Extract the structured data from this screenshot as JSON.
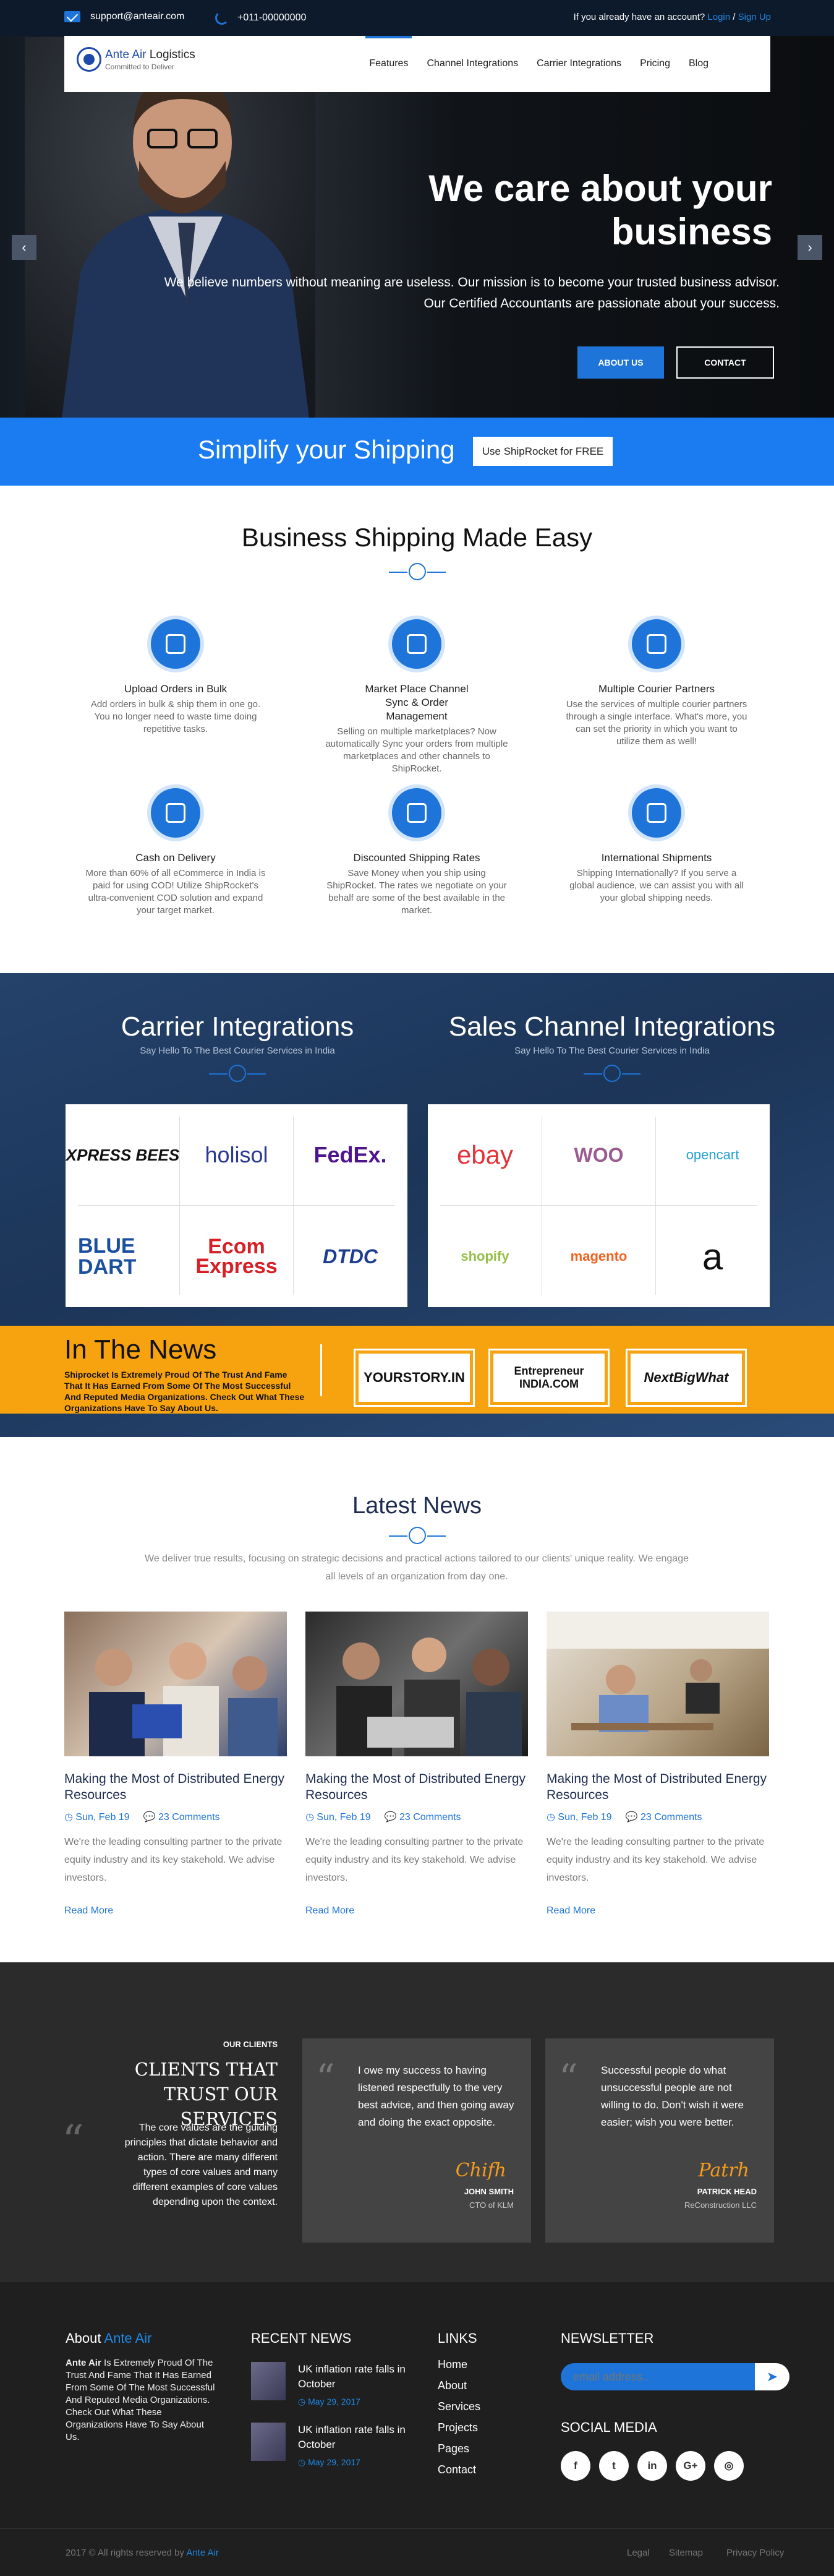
{
  "topbar": {
    "email": "support@anteair.com",
    "phone": "+011-00000000",
    "account_text": "If you already have an account?",
    "login": "Login",
    "sep": "/",
    "signup": "Sign Up"
  },
  "logo": {
    "name_part1": "Ante Air",
    "name_part2": "Logistics",
    "tagline": "Committed to Deliver"
  },
  "nav": [
    "Features",
    "Channel Integrations",
    "Carrier Integrations",
    "Pricing",
    "Blog"
  ],
  "hero": {
    "title": "We care about your business",
    "subtitle": "We believe numbers without meaning are useless. Our mission is to become your trusted business advisor. Our Certified Accountants are passionate about your success.",
    "btn_about": "ABOUT US",
    "btn_contact": "CONTACT",
    "prev": "‹",
    "next": "›"
  },
  "simplify": {
    "text": "Simplify your Shipping",
    "button": "Use ShipRocket for FREE"
  },
  "business": {
    "title": "Business Shipping Made Easy",
    "features": [
      {
        "icon": "upload-icon",
        "title": "Upload Orders in Bulk",
        "desc": "Add orders in bulk & ship them in one go. You no longer need to waste time doing repetitive tasks."
      },
      {
        "icon": "sync-icon",
        "title": "Market Place Channel Sync & Order Management",
        "desc": "Selling on multiple marketplaces? Now automatically Sync your orders from multiple marketplaces and other channels to ShipRocket."
      },
      {
        "icon": "handshake-icon",
        "title": "Multiple Courier Partners",
        "desc": "Use the services of multiple courier partners through a single interface. What's more, you can set the priority in which you want to utilize them as well!"
      },
      {
        "icon": "delivery-truck-icon",
        "title": "Cash on Delivery",
        "desc": "More than 60% of all eCommerce in India is paid for using COD! Utilize ShipRocket's ultra-convenient COD solution and expand your target market."
      },
      {
        "icon": "money-bag-icon",
        "title": "Discounted Shipping Rates",
        "desc": "Save Money when you ship using ShipRocket. The rates we negotiate on your behalf are some of the best available in the market."
      },
      {
        "icon": "plane-icon",
        "title": "International Shipments",
        "desc": "Shipping Internationally? If you serve a global audience, we can assist you with all your global shipping needs."
      }
    ]
  },
  "integrations": {
    "carrier_title": "Carrier Integrations",
    "carrier_sub": "Say Hello To The Best Courier Services in India",
    "sales_title": "Sales Channel Integrations",
    "sales_sub": "Say Hello To The Best Courier Services in India",
    "carriers": [
      {
        "name": "XPRESS BEES",
        "color": "#111"
      },
      {
        "name": "holisol",
        "color": "#2b3990"
      },
      {
        "name": "FedEx.",
        "color": "#4d148c"
      },
      {
        "name": "BLUE DART",
        "color": "#1b4fa0"
      },
      {
        "name": "Ecom Express",
        "color": "#d71f26"
      },
      {
        "name": "DTDC",
        "color": "#1d3d8f"
      }
    ],
    "channels": [
      {
        "name": "ebay",
        "color": "#e53238"
      },
      {
        "name": "WOO",
        "color": "#9b5c8f"
      },
      {
        "name": "opencart",
        "color": "#23a1d1"
      },
      {
        "name": "shopify",
        "color": "#95bf47"
      },
      {
        "name": "magento",
        "color": "#f26322"
      },
      {
        "name": "a",
        "color": "#111"
      }
    ]
  },
  "in_the_news": {
    "title": "In The News",
    "desc": "Shiprocket Is Extremely Proud Of The Trust And Fame That It Has Earned From Some Of The Most Successful And Reputed Media Organizations. Check Out What These Organizations Have To Say About Us.",
    "press": [
      "YOURSTORY.IN",
      "Entrepreneur INDIA.COM",
      "NextBigWhat"
    ]
  },
  "latest": {
    "title": "Latest News",
    "intro": "We deliver true results, focusing on strategic decisions and practical actions tailored to our clients' unique reality. We engage all levels of an organization from day one.",
    "cards": [
      {
        "title": "Making the Most of Distributed Energy Resources",
        "date": "Sun, Feb 19",
        "comments": "23 Comments",
        "desc": "We're the leading consulting partner to the private equity industry and its key stakehold. We advise investors.",
        "more": "Read More"
      },
      {
        "title": "Making the Most of Distributed Energy Resources",
        "date": "Sun, Feb 19",
        "comments": "23 Comments",
        "desc": "We're the leading consulting partner to the private equity industry and its key stakehold. We advise investors.",
        "more": "Read More"
      },
      {
        "title": "Making the Most of Distributed Energy Resources",
        "date": "Sun, Feb 19",
        "comments": "23 Comments",
        "desc": "We're the leading consulting partner to the private equity industry and its key stakehold. We advise investors.",
        "more": "Read More"
      }
    ]
  },
  "clients": {
    "kicker": "OUR CLIENTS",
    "title": "CLIENTS THAT TRUST OUR SERVICES",
    "desc": "The core values are the guiding principles that dictate behavior and action. There are many different types of core values and many different examples of core values depending upon the context.",
    "testimonials": [
      {
        "text": "I owe my success to having listened respectfully to the very best advice, and then going away and doing the exact opposite.",
        "name": "JOHN SMITH",
        "role": "CTO of KLM"
      },
      {
        "text": "Successful people do what unsuccessful people are not willing to do. Don't wish it were easier; wish you were better.",
        "name": "PATRICK HEAD",
        "role": "ReConstruction LLC"
      }
    ]
  },
  "footer": {
    "about_title_1": "About",
    "about_title_2": "Ante Air",
    "about_lead": "Ante Air",
    "about_text": "Is Extremely Proud Of The Trust And Fame That It Has Earned From Some Of The Most Successful And Reputed Media Organizations. Check Out What These Organizations Have To Say About Us.",
    "recent_title": "RECENT NEWS",
    "recent": [
      {
        "title": "UK inflation rate falls in October",
        "date": "May 29, 2017"
      },
      {
        "title": "UK inflation rate falls in October",
        "date": "May 29, 2017"
      }
    ],
    "links_title": "LINKS",
    "links": [
      "Home",
      "About",
      "Services",
      "Projects",
      "Pages",
      "Contact"
    ],
    "newsletter_title": "NEWSLETTER",
    "newsletter_placeholder": "email address..",
    "social_title": "SOCIAL MEDIA",
    "social": [
      "f",
      "t",
      "in",
      "G+",
      "◎"
    ],
    "copyright_pre": "2017 © All rights reserved by",
    "copyright_brand": "Ante Air",
    "bottom_links": [
      "Legal",
      "Sitemap",
      "Privacy Policy"
    ]
  }
}
